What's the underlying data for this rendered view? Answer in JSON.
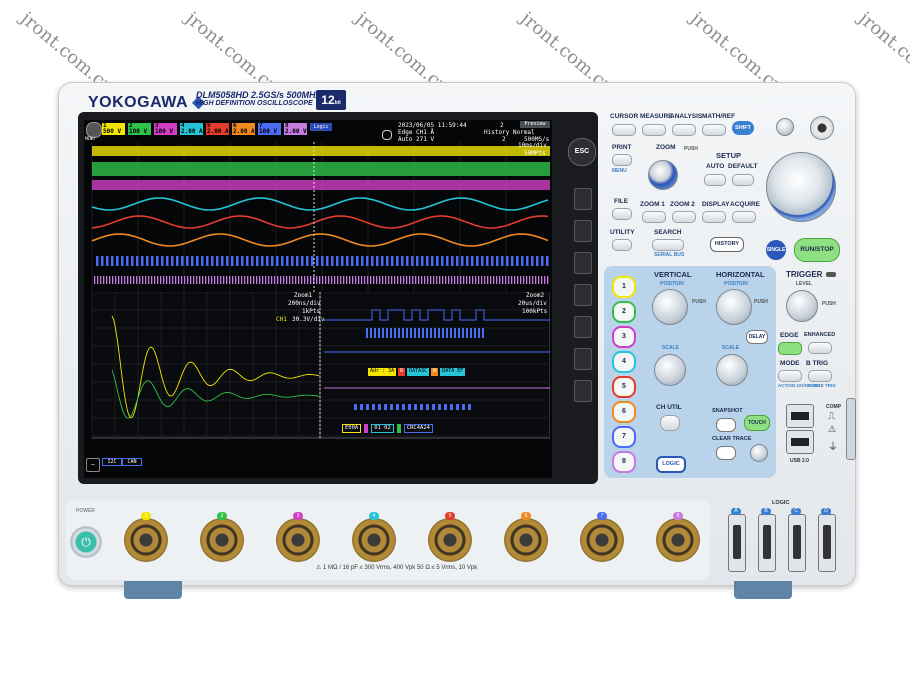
{
  "brand": {
    "logo": "YOKOGAWA",
    "model": "DLM5058HD  2.5GS/s 500MHz",
    "subtitle": "HIGH DEFINITION OSCILLOSCOPE",
    "bit_badge": "12"
  },
  "screen": {
    "menu_label": "MENU",
    "channels": [
      {
        "num": "1",
        "val": "500 V",
        "color": "#f2e600"
      },
      {
        "num": "2",
        "val": "100 V",
        "color": "#2fc24a"
      },
      {
        "num": "3",
        "val": "100 V",
        "color": "#d23ec6"
      },
      {
        "num": "4",
        "val": "2.00 A",
        "color": "#25c4d6"
      },
      {
        "num": "5",
        "val": "2.00 A",
        "color": "#e33b2c"
      },
      {
        "num": "6",
        "val": "2.00 A",
        "color": "#f08a20"
      },
      {
        "num": "7",
        "val": "100 V",
        "color": "#4a6cf2"
      },
      {
        "num": "8",
        "val": "2.00 V",
        "color": "#c77ae0"
      }
    ],
    "logic_label": "Logic",
    "datetime": "2023/06/05 11:59:44",
    "acq_count": "2",
    "mode": "Preview",
    "trigger_edge": "Edge CH1 Å",
    "history": "History Normal",
    "auto_level": "Auto 271 V",
    "history_count": "2",
    "sample_rate": "500MS/s",
    "time_div": "10ms/div",
    "points": "50MPts",
    "zoom1": {
      "title": "Zoom1",
      "tdiv": "200ns/div",
      "pts": "1kPts",
      "ch": "CH1",
      "scale": "30.3V/div"
    },
    "zoom2": {
      "title": "Zoom2",
      "tdiv": "20us/div",
      "pts": "100kPts"
    },
    "decode_row1": [
      "Adr : 3A",
      "R",
      "DATA3C",
      "W",
      "DATA EF"
    ],
    "decode_row2": [
      "E00A",
      "",
      "01 02",
      "",
      "CRC4A24"
    ],
    "bus_labels": [
      "I2C",
      "CAN"
    ]
  },
  "panel": {
    "top_buttons": [
      "CURSOR",
      "MEASURE",
      "ANALYSIS",
      "MATH/REF"
    ],
    "shift": "SHIFT",
    "print": "PRINT",
    "menu": "MENU",
    "zoom": "ZOOM",
    "push": "PUSH",
    "setup": "SETUP",
    "auto": "AUTO",
    "default": "DEFAULT",
    "file": "FILE",
    "zoom1": "ZOOM 1",
    "zoom2": "ZOOM 2",
    "display": "DISPLAY",
    "acquire": "ACQUIRE",
    "utility": "UTILITY",
    "search": "SEARCH",
    "serial_bus": "SERIAL BUS",
    "history": "HISTORY",
    "single": "SINGLE",
    "run_stop": "RUN/STOP",
    "vertical": "VERTICAL",
    "horizontal": "HORIZONTAL",
    "position": "POSITION",
    "scale": "SCALE",
    "delay": "DELAY",
    "trigger": "TRIGGER",
    "level": "LEVEL",
    "edge": "EDGE",
    "enhanced": "ENHANCED",
    "mode": "MODE",
    "b_trig": "B TRIG",
    "action": "ACTION GO/NO-GO",
    "force_trig": "FORCE TRIG",
    "ch_util": "CH UTIL",
    "logic": "LOGIC",
    "snapshot": "SNAPSHOT",
    "clear_trace": "CLEAR TRACE",
    "touch": "TOUCH",
    "esc": "ESC",
    "ch_buttons": [
      "1",
      "2",
      "3",
      "4",
      "5",
      "6",
      "7",
      "8"
    ],
    "usb": "USB 2.0",
    "comp": "COMP",
    "logic_ports": [
      "A",
      "B",
      "C",
      "D"
    ],
    "logic_port_label": "LOGIC"
  },
  "front": {
    "power": "POWER",
    "spec": "⚠ 1 MΩ / 16 pF ≤ 300 Vrms, 400 Vpk   50 Ω ≤ 5 Vrms, 10 Vpk",
    "bnc_labels": [
      "1",
      "2",
      "3",
      "4",
      "5",
      "6",
      "7",
      "8"
    ]
  },
  "watermarks": [
    "jront.com.cn"
  ]
}
